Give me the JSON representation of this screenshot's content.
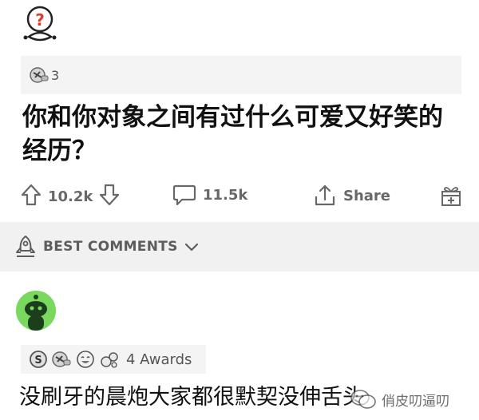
{
  "post": {
    "award_count": "3",
    "title": "你和你对象之间有过什么可爱又好笑的经历？"
  },
  "actions": {
    "upvotes": "10.2k",
    "comments": "11.5k",
    "share_label": "Share"
  },
  "sort": {
    "label": "BEST COMMENTS"
  },
  "comment": {
    "awards_label": "4 Awards",
    "text": "没刷牙的晨炮大家都很默契没伸舌头"
  },
  "watermark": {
    "text": "俏皮叨逼叨"
  },
  "colors": {
    "avatar_green": "#7ad85f",
    "band_gray": "#f1f1f1",
    "icon_gray": "#686868"
  }
}
